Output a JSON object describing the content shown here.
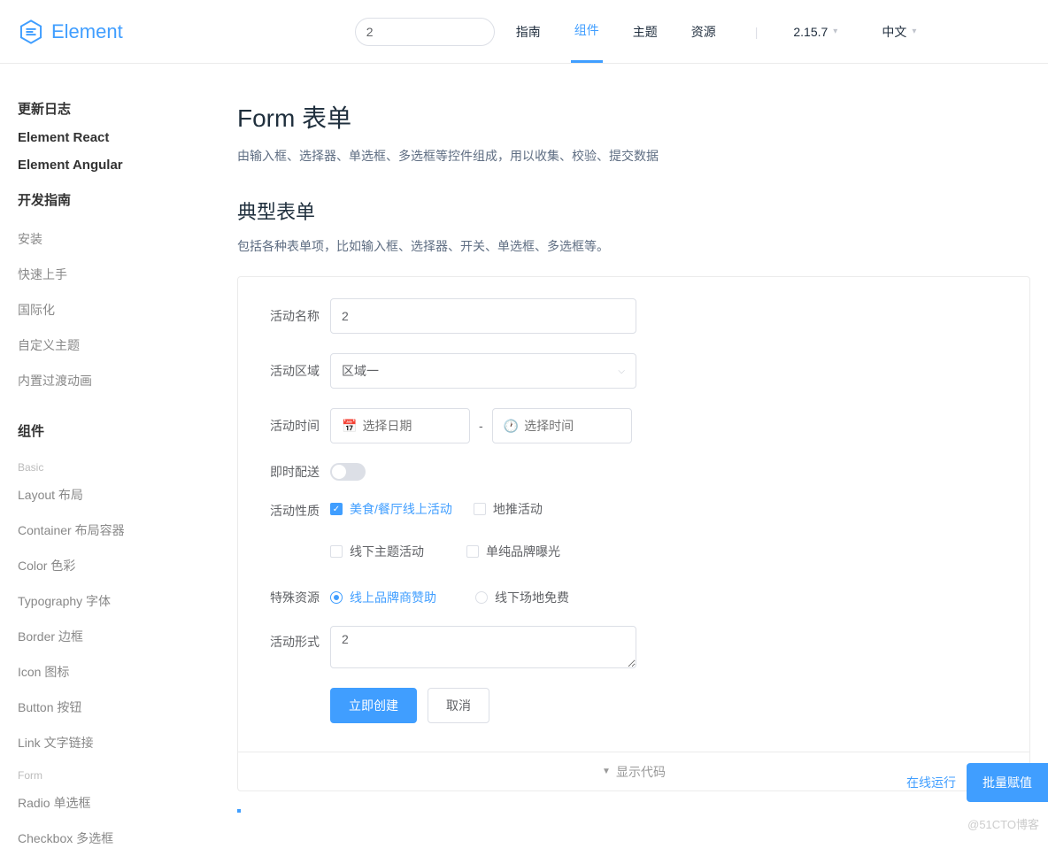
{
  "header": {
    "logo_text": "Element",
    "search_value": "2",
    "nav": {
      "guide": "指南",
      "component": "组件",
      "theme": "主题",
      "resource": "资源"
    },
    "version": "2.15.7",
    "language": "中文"
  },
  "sidebar": {
    "changelog": "更新日志",
    "react": "Element React",
    "angular": "Element Angular",
    "dev_guide": "开发指南",
    "install": "安装",
    "quickstart": "快速上手",
    "i18n": "国际化",
    "custom_theme": "自定义主题",
    "transition": "内置过渡动画",
    "components": "组件",
    "basic_label": "Basic",
    "layout": "Layout 布局",
    "container": "Container 布局容器",
    "color": "Color 色彩",
    "typography": "Typography 字体",
    "border": "Border 边框",
    "icon": "Icon 图标",
    "button": "Button 按钮",
    "link": "Link 文字链接",
    "form_label": "Form",
    "radio": "Radio 单选框",
    "checkbox": "Checkbox 多选框"
  },
  "main": {
    "title": "Form 表单",
    "subtitle": "由输入框、选择器、单选框、多选框等控件组成，用以收集、校验、提交数据",
    "section_title": "典型表单",
    "section_desc": "包括各种表单项，比如输入框、选择器、开关、单选框、多选框等。"
  },
  "form": {
    "name_label": "活动名称",
    "name_value": "2",
    "region_label": "活动区域",
    "region_value": "区域一",
    "time_label": "活动时间",
    "date_placeholder": "选择日期",
    "time_placeholder": "选择时间",
    "date_sep": "-",
    "delivery_label": "即时配送",
    "nature_label": "活动性质",
    "nature_options": {
      "opt1": "美食/餐厅线上活动",
      "opt2": "地推活动",
      "opt3": "线下主题活动",
      "opt4": "单纯品牌曝光"
    },
    "resource_label": "特殊资源",
    "resource_options": {
      "opt1": "线上品牌商赞助",
      "opt2": "线下场地免费"
    },
    "desc_label": "活动形式",
    "desc_value": "2",
    "submit_btn": "立即创建",
    "cancel_btn": "取消"
  },
  "demo_footer": "显示代码",
  "float": {
    "online_run": "在线运行",
    "batch_assign": "批量赋值"
  },
  "watermark": "@51CTO博客"
}
